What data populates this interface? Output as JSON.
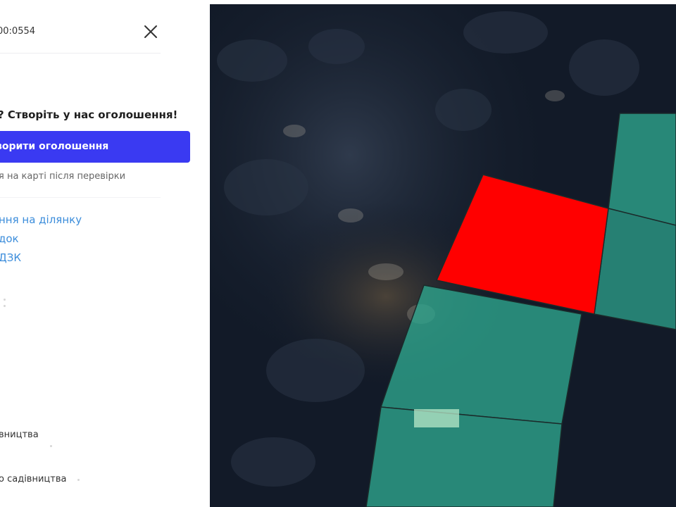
{
  "panel": {
    "cadastral_fragment": "00:0554",
    "promo_title": "? Створіть у нас оголошення!",
    "cta_label": "ворити оголошення",
    "note": "я на карті після перевірки",
    "links": [
      "ння на ділянку",
      "док",
      "ДЗК"
    ],
    "purpose_items": [
      "вництва",
      "о садівництва"
    ]
  },
  "map": {
    "colors": {
      "selected_parcel": "#ff0000",
      "other_parcels": "#2ea890",
      "accent_button": "#3a3af2",
      "link": "#3c8ddb"
    }
  }
}
